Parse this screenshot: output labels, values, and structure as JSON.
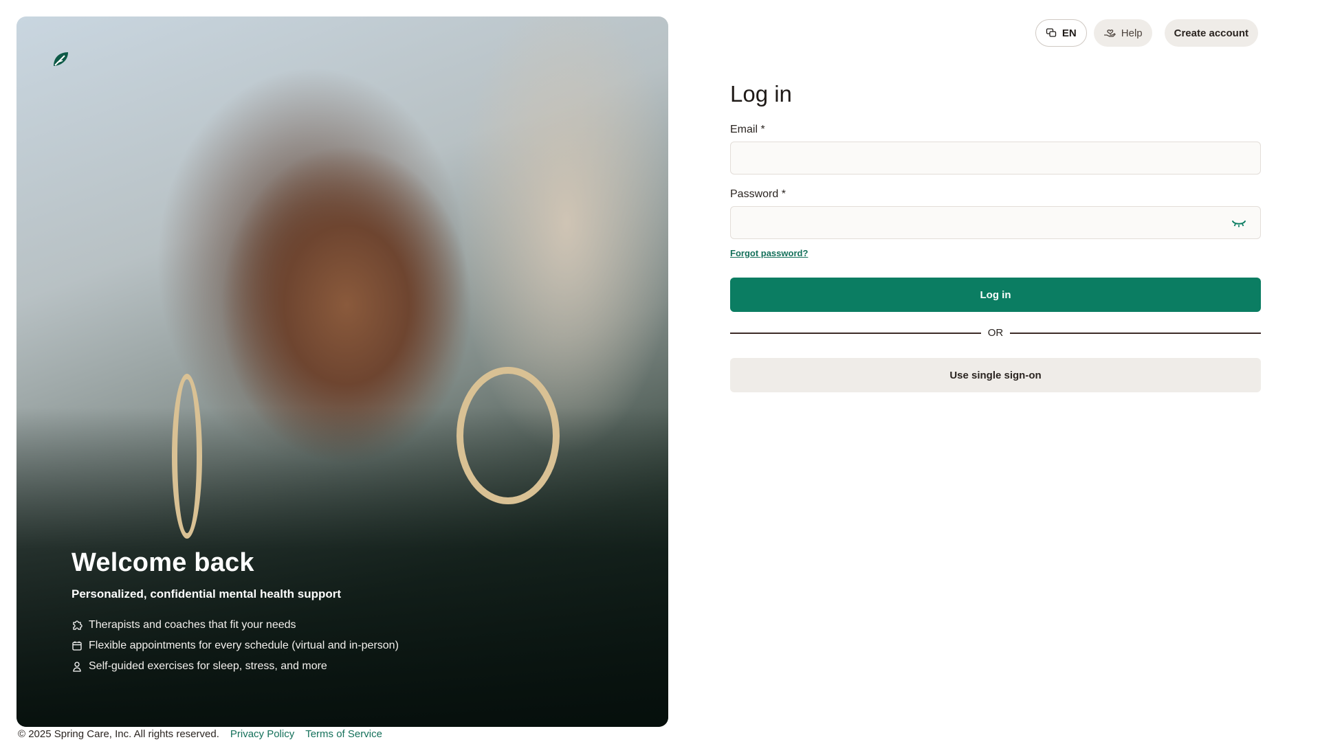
{
  "nav": {
    "language": "EN",
    "help": "Help",
    "create_account": "Create account"
  },
  "hero": {
    "title": "Welcome back",
    "subtitle": "Personalized, confidential mental health support",
    "features": [
      "Therapists and coaches that fit your needs",
      "Flexible appointments for every schedule (virtual and in-person)",
      "Self-guided exercises for sleep, stress, and more"
    ]
  },
  "form": {
    "title": "Log in",
    "email_label": "Email *",
    "email_value": "",
    "password_label": "Password *",
    "password_value": "",
    "forgot": "Forgot password?",
    "login_button": "Log in",
    "or": "OR",
    "sso_button": "Use single sign-on"
  },
  "footer": {
    "copyright": "© 2025 Spring Care, Inc. All rights reserved.",
    "privacy": "Privacy Policy",
    "terms": "Terms of Service"
  },
  "colors": {
    "primary": "#0b7d62",
    "link": "#14705a",
    "secondary_bg": "#efece8"
  }
}
